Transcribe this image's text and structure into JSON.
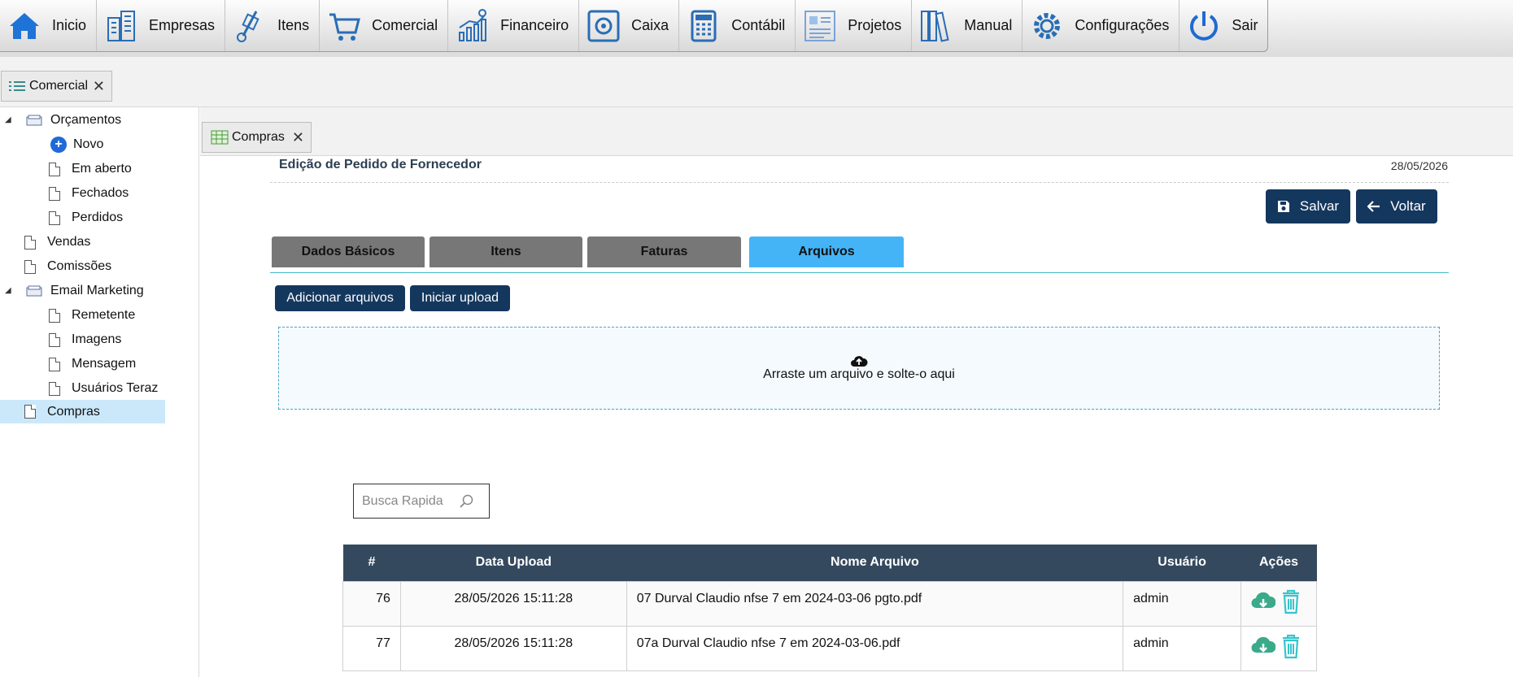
{
  "nav": [
    {
      "label": "Inicio",
      "icon": "home-icon"
    },
    {
      "label": "Empresas",
      "icon": "buildings-icon"
    },
    {
      "label": "Itens",
      "icon": "hand-truck-icon"
    },
    {
      "label": "Comercial",
      "icon": "shopping-cart-icon"
    },
    {
      "label": "Financeiro",
      "icon": "finance-chart-icon"
    },
    {
      "label": "Caixa",
      "icon": "safe-icon"
    },
    {
      "label": "Contábil",
      "icon": "calculator-icon"
    },
    {
      "label": "Projetos",
      "icon": "projects-board-icon"
    },
    {
      "label": "Manual",
      "icon": "binders-icon"
    },
    {
      "label": "Configurações",
      "icon": "gear-icon"
    },
    {
      "label": "Sair",
      "icon": "power-icon"
    }
  ],
  "module_tab": {
    "label": "Comercial"
  },
  "sidebar": {
    "orcamentos": "Orçamentos",
    "novo": "Novo",
    "em_aberto": "Em aberto",
    "fechados": "Fechados",
    "perdidos": "Perdidos",
    "vendas": "Vendas",
    "comissoes": "Comissões",
    "email_marketing": "Email Marketing",
    "remetente": "Remetente",
    "imagens": "Imagens",
    "mensagem": "Mensagem",
    "usuarios_teraz": "Usuários Teraz",
    "compras": "Compras"
  },
  "doc_tab": {
    "label": "Compras"
  },
  "page": {
    "title": "Edição de Pedido de Fornecedor",
    "date": "28/05/2026",
    "save_label": "Salvar",
    "back_label": "Voltar"
  },
  "form_tabs": [
    "Dados Básicos",
    "Itens",
    "Faturas",
    "Arquivos"
  ],
  "upload": {
    "add_label": "Adicionar arquivos",
    "start_label": "Iniciar upload",
    "drop_text": "Arraste um arquivo e solte-o aqui"
  },
  "search": {
    "placeholder": "Busca Rapida"
  },
  "table": {
    "headers": [
      "#",
      "Data Upload",
      "Nome Arquivo",
      "Usuário",
      "Ações"
    ],
    "rows": [
      {
        "id": "76",
        "date": "28/05/2026 15:11:28",
        "name": "07 Durval Claudio nfse 7 em 2024-03-06 pgto.pdf",
        "user": "admin"
      },
      {
        "id": "77",
        "date": "28/05/2026 15:11:28",
        "name": "07a Durval Claudio nfse 7 em 2024-03-06.pdf",
        "user": "admin"
      }
    ]
  },
  "colors": {
    "accent_dark": "#14375e",
    "active_tab": "#44b4f7",
    "inactive_tab": "#777777",
    "header": "#34495e"
  }
}
